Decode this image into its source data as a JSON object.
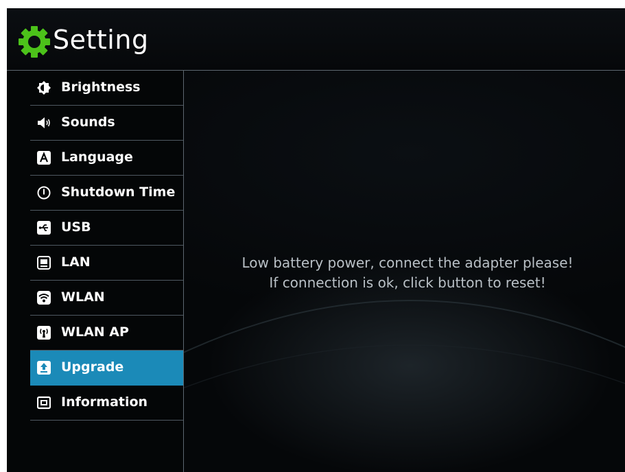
{
  "app": {
    "title": "Setting",
    "accent_color": "#1b8ab8",
    "gear_color": "#4cc21a"
  },
  "sidebar": {
    "items": [
      {
        "label": "Brightness",
        "icon": "brightness-icon",
        "active": false
      },
      {
        "label": "Sounds",
        "icon": "speaker-icon",
        "active": false
      },
      {
        "label": "Language",
        "icon": "language-icon",
        "active": false
      },
      {
        "label": "Shutdown Time",
        "icon": "power-icon",
        "active": false
      },
      {
        "label": "USB",
        "icon": "usb-icon",
        "active": false
      },
      {
        "label": "LAN",
        "icon": "lan-icon",
        "active": false
      },
      {
        "label": "WLAN",
        "icon": "wifi-icon",
        "active": false
      },
      {
        "label": "WLAN AP",
        "icon": "wireless-ap-icon",
        "active": false
      },
      {
        "label": "Upgrade",
        "icon": "upgrade-icon",
        "active": true
      },
      {
        "label": "Information",
        "icon": "information-icon",
        "active": false
      }
    ]
  },
  "main": {
    "message_line1": "Low battery power, connect the adapter please!",
    "message_line2": "If connection is ok, click button to reset!"
  }
}
